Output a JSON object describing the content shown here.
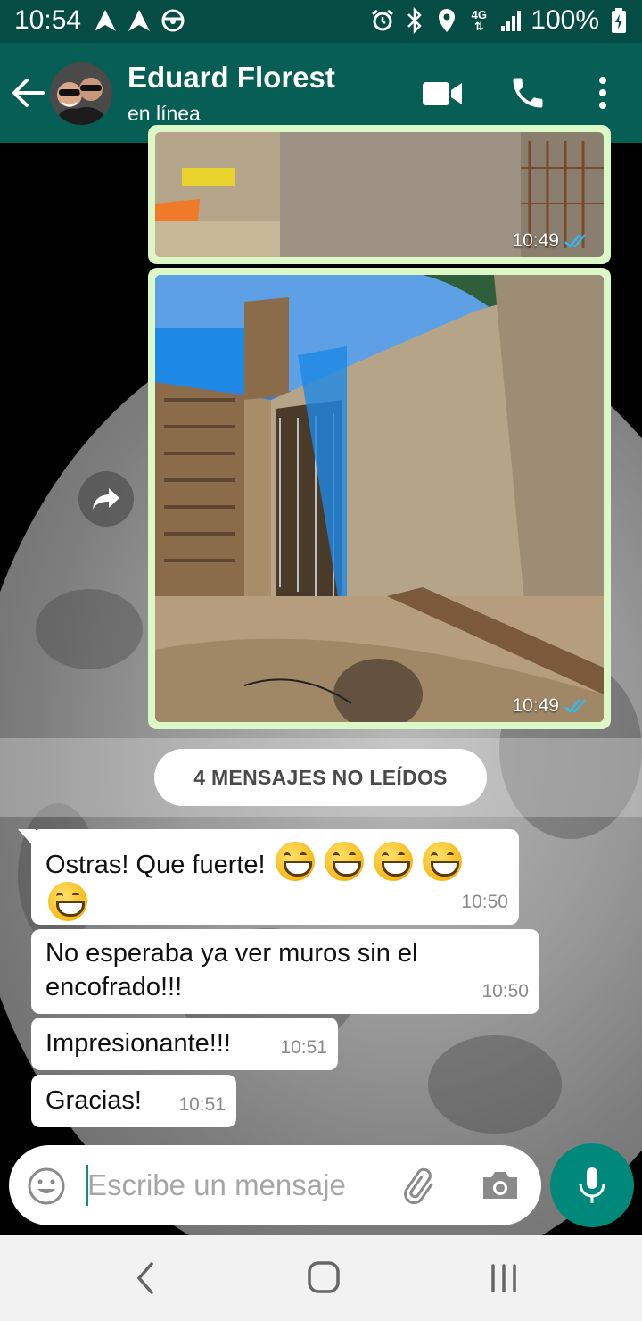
{
  "status_bar": {
    "time": "10:54",
    "network": "4G",
    "battery": "100%",
    "icons": [
      "nav-arrow-icon",
      "nav-arrow-icon",
      "steering-wheel-icon",
      "alarm-icon",
      "bluetooth-icon",
      "location-icon",
      "signal-icon",
      "battery-charging-icon"
    ]
  },
  "header": {
    "contact_name": "Eduard Florest",
    "status": "en línea",
    "icons": [
      "back-arrow-icon",
      "avatar",
      "video-call-icon",
      "phone-icon",
      "more-vert-icon"
    ],
    "color": "#075e54"
  },
  "messages": {
    "images": [
      {
        "time": "10:49",
        "read_ticks": "double-blue"
      },
      {
        "time": "10:49",
        "read_ticks": "double-blue"
      }
    ],
    "unread_banner": "4 MENSAJES NO LEÍDOS",
    "incoming": [
      {
        "text": "Ostras! Que fuerte!",
        "emoji": [
          "grinning-face",
          "grinning-face",
          "grinning-face",
          "grinning-face",
          "grinning-face"
        ],
        "time": "10:50"
      },
      {
        "line1": "No esperaba ya ver muros sin el",
        "line2": "encofrado!!!",
        "time": "10:50"
      },
      {
        "text": "Impresionante!!!",
        "time": "10:51"
      },
      {
        "text": "Gracias!",
        "time": "10:51"
      }
    ]
  },
  "composer": {
    "placeholder": "Escribe un mensaje",
    "value": "",
    "icons": [
      "emoji-icon",
      "attach-icon",
      "camera-icon",
      "mic-icon"
    ],
    "accent": "#00897b"
  },
  "colors": {
    "outgoing_bubble": "#dcf8c6",
    "incoming_bubble": "#ffffff",
    "read_tick": "#34b7f1"
  }
}
